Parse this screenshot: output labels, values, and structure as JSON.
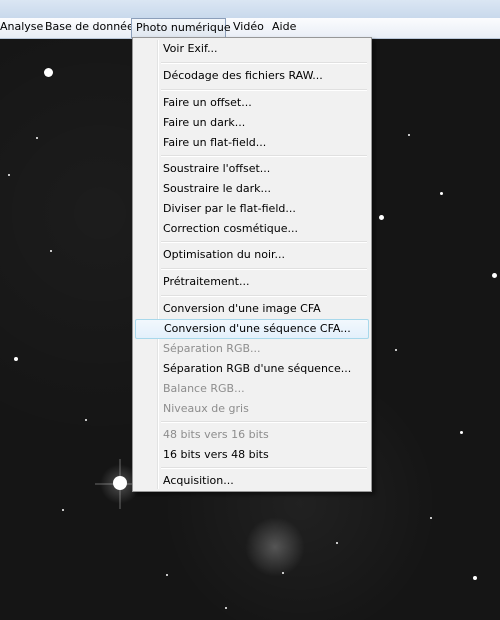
{
  "menubar": {
    "items": [
      "Analyse",
      "Base de données",
      "Photo numérique",
      "Vidéo",
      "Aide"
    ]
  },
  "dropdown": {
    "items": [
      {
        "label": "Voir Exif...",
        "disabled": false
      },
      {
        "label": "Décodage des fichiers RAW...",
        "disabled": false
      },
      {
        "label": "Faire un offset...",
        "disabled": false
      },
      {
        "label": "Faire un dark...",
        "disabled": false
      },
      {
        "label": "Faire un flat-field...",
        "disabled": false
      },
      {
        "label": "Soustraire l'offset...",
        "disabled": false
      },
      {
        "label": "Soustraire le dark...",
        "disabled": false
      },
      {
        "label": "Diviser par le flat-field...",
        "disabled": false
      },
      {
        "label": "Correction cosmétique...",
        "disabled": false
      },
      {
        "label": "Optimisation du noir...",
        "disabled": false
      },
      {
        "label": "Prétraitement...",
        "disabled": false
      },
      {
        "label": "Conversion d'une image CFA",
        "disabled": false
      },
      {
        "label": "Conversion d'une séquence CFA...",
        "disabled": false,
        "highlighted": true
      },
      {
        "label": "Séparation RGB...",
        "disabled": true
      },
      {
        "label": "Séparation RGB d'une séquence...",
        "disabled": false
      },
      {
        "label": "Balance RGB...",
        "disabled": true
      },
      {
        "label": "Niveaux de gris",
        "disabled": true
      },
      {
        "label": "48 bits vers 16 bits",
        "disabled": true
      },
      {
        "label": "16 bits vers 48 bits",
        "disabled": false
      },
      {
        "label": "Acquisition...",
        "disabled": false
      }
    ]
  }
}
